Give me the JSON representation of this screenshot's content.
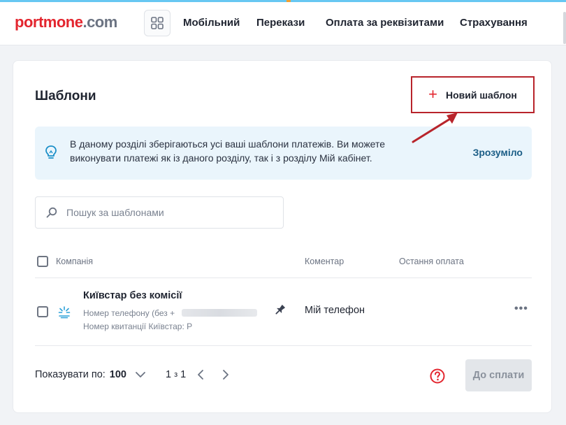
{
  "header": {
    "logo_brand": "portmone",
    "logo_domain": ".com",
    "nav": [
      "Мобільний",
      "Перекази",
      "Оплата за реквізитами",
      "Страхування"
    ]
  },
  "page": {
    "title": "Шаблони",
    "new_template_label": "Новий шаблон"
  },
  "info": {
    "text": "В даному розділі зберігаються усі ваші шаблони платежів. Ви можете виконувати платежі як із даного розділу, так і з розділу Мій кабінет.",
    "dismiss_label": "Зрозуміло"
  },
  "search": {
    "placeholder": "Пошук за шаблонами"
  },
  "table": {
    "columns": [
      "Компанія",
      "Коментар",
      "Остання оплата"
    ],
    "rows": [
      {
        "name": "Київстар без комісії",
        "detail1": "Номер телефону (без +",
        "detail2": "Номер квитанції Київстар: Р",
        "comment": "Мій телефон",
        "last_payment": ""
      }
    ]
  },
  "footer": {
    "show_label": "Показувати по:",
    "page_size": "100",
    "page_current": "1",
    "page_of": "з",
    "page_total": "1",
    "pay_label": "До сплати"
  },
  "colors": {
    "brand_red": "#e3262f",
    "annotation_red": "#b8242b",
    "info_bg": "#eaf5fc",
    "link_blue": "#1b5d86"
  }
}
